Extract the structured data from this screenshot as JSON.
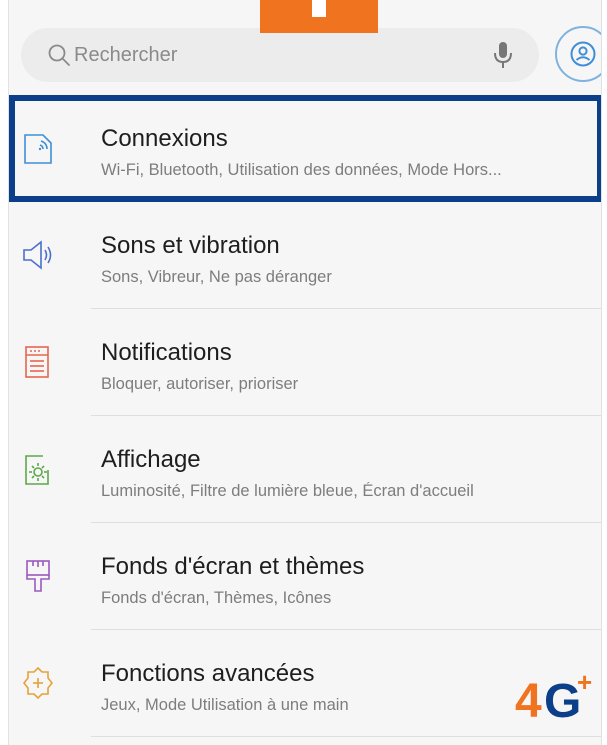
{
  "search": {
    "placeholder": "Rechercher"
  },
  "settings": {
    "items": [
      {
        "title": "Connexions",
        "subtitle": "Wi-Fi, Bluetooth, Utilisation des données, Mode Hors...",
        "icon": "connections-icon",
        "selected": true
      },
      {
        "title": "Sons et vibration",
        "subtitle": "Sons, Vibreur, Ne pas déranger",
        "icon": "speaker-icon",
        "selected": false
      },
      {
        "title": "Notifications",
        "subtitle": "Bloquer, autoriser, prioriser",
        "icon": "notifications-icon",
        "selected": false
      },
      {
        "title": "Affichage",
        "subtitle": "Luminosité, Filtre de lumière bleue, Écran d'accueil",
        "icon": "display-brightness-icon",
        "selected": false
      },
      {
        "title": "Fonds d'écran et thèmes",
        "subtitle": "Fonds d'écran, Thèmes, Icônes",
        "icon": "paint-brush-icon",
        "selected": false
      },
      {
        "title": "Fonctions avancées",
        "subtitle": "Jeux, Mode Utilisation à une main",
        "icon": "advanced-features-icon",
        "selected": false
      }
    ]
  },
  "badge": {
    "text": "4G+"
  },
  "colors": {
    "selection_outline": "#0b3f8a",
    "orange_accent": "#f0731f",
    "connexions_icon": "#3f8fd6",
    "sounds_icon": "#4a6fd0",
    "notifications_icon": "#e8664f",
    "display_icon": "#5ea84a",
    "wallpaper_icon": "#9a5ac0",
    "advanced_icon": "#e6a23a"
  }
}
